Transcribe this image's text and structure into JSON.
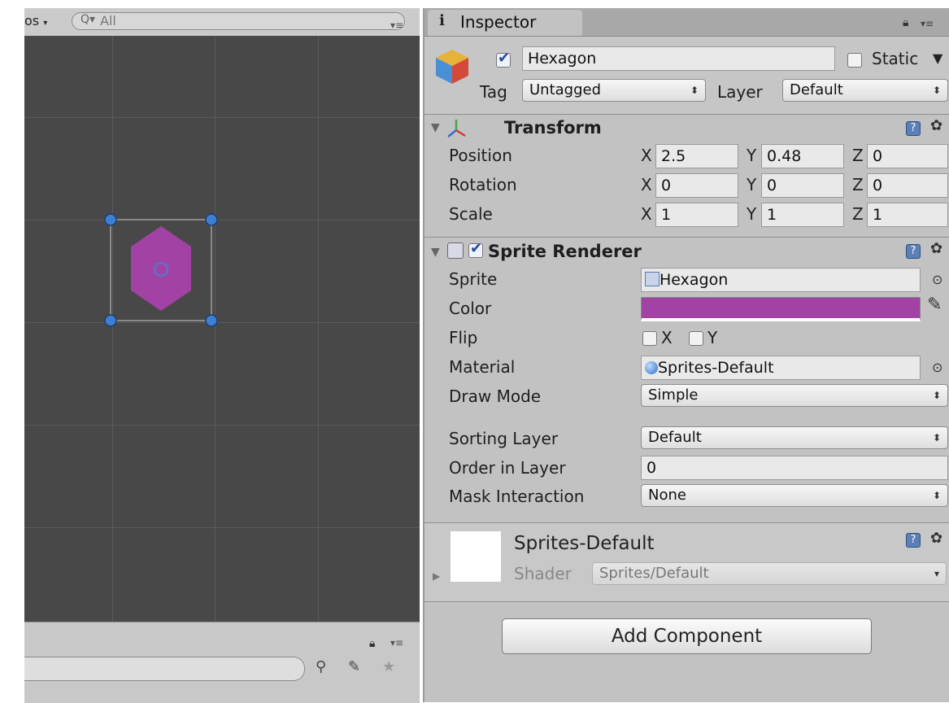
{
  "scene": {
    "toolbar_label": "os",
    "search_placeholder": "All",
    "sprite_color": "#a142a4"
  },
  "inspector": {
    "tab_label": "Inspector",
    "object": {
      "name": "Hexagon",
      "static_label": "Static",
      "tag_label": "Tag",
      "tag_value": "Untagged",
      "layer_label": "Layer",
      "layer_value": "Default"
    },
    "transform": {
      "title": "Transform",
      "rows": [
        {
          "label": "Position",
          "x": "2.5",
          "y": "0.48",
          "z": "0"
        },
        {
          "label": "Rotation",
          "x": "0",
          "y": "0",
          "z": "0"
        },
        {
          "label": "Scale",
          "x": "1",
          "y": "1",
          "z": "1"
        }
      ]
    },
    "sprite_renderer": {
      "title": "Sprite Renderer",
      "sprite_label": "Sprite",
      "sprite_value": "Hexagon",
      "color_label": "Color",
      "color_value": "#a142a4",
      "flip_label": "Flip",
      "flip_x": "X",
      "flip_y": "Y",
      "material_label": "Material",
      "material_value": "Sprites-Default",
      "draw_mode_label": "Draw Mode",
      "draw_mode_value": "Simple",
      "sorting_layer_label": "Sorting Layer",
      "sorting_layer_value": "Default",
      "order_label": "Order in Layer",
      "order_value": "0",
      "mask_label": "Mask Interaction",
      "mask_value": "None"
    },
    "material": {
      "name": "Sprites-Default",
      "shader_label": "Shader",
      "shader_value": "Sprites/Default"
    },
    "add_component_label": "Add Component"
  },
  "axis_labels": {
    "x": "X",
    "y": "Y",
    "z": "Z"
  }
}
